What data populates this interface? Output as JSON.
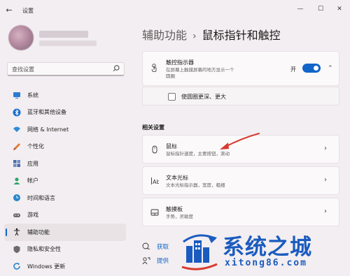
{
  "window": {
    "title": "设置"
  },
  "search": {
    "placeholder": "查找设置"
  },
  "sidebar": {
    "items": [
      {
        "label": "系统",
        "icon": "system-icon",
        "color": "#2b7bd1"
      },
      {
        "label": "蓝牙和其他设备",
        "icon": "bluetooth-icon",
        "color": "#1a6fce"
      },
      {
        "label": "网络 & Internet",
        "icon": "wifi-icon",
        "color": "#2f8bd8"
      },
      {
        "label": "个性化",
        "icon": "brush-icon",
        "color": "#e07b39"
      },
      {
        "label": "应用",
        "icon": "apps-icon",
        "color": "#4a6ba8"
      },
      {
        "label": "帐户",
        "icon": "account-icon",
        "color": "#2ea56a"
      },
      {
        "label": "时间和语言",
        "icon": "clock-globe-icon",
        "color": "#2a86c9"
      },
      {
        "label": "游戏",
        "icon": "gamepad-icon",
        "color": "#6b6b6b"
      },
      {
        "label": "辅助功能",
        "icon": "accessibility-icon",
        "color": "#1b1b1b",
        "active": true
      },
      {
        "label": "隐私和安全性",
        "icon": "shield-icon",
        "color": "#6b6b6b"
      },
      {
        "label": "Windows 更新",
        "icon": "update-icon",
        "color": "#2a86c9"
      }
    ]
  },
  "main": {
    "breadcrumb_parent": "辅助功能",
    "breadcrumb_separator": "›",
    "breadcrumb_current": "鼠标指针和触控",
    "touch_indicator": {
      "title": "触控指示器",
      "description_line1": "在屏幕上触摸屏幕的地方显示一个",
      "description_line2": "圆圈",
      "toggle_label": "开",
      "toggle_on": true
    },
    "darker_circle": {
      "label": "使圆圈更深、更大",
      "checked": false
    },
    "related_heading": "相关设置",
    "related": [
      {
        "title": "鼠标",
        "description": "鼠标指针速度，主要按钮，滚动",
        "icon": "mouse-icon"
      },
      {
        "title": "文本光标",
        "description": "文本光标指示器，宽度，粗细",
        "icon": "text-cursor-icon"
      },
      {
        "title": "触摸板",
        "description": "手势，灵敏度",
        "icon": "touchpad-icon"
      }
    ],
    "help": [
      {
        "label": "获取",
        "icon": "help-icon"
      },
      {
        "label": "提供",
        "icon": "feedback-icon"
      }
    ]
  },
  "watermark": {
    "title": "系统之城",
    "url": "xitong86.com"
  },
  "colors": {
    "accent": "#1264c9",
    "background": "#f3eef1",
    "card": "#fbf9fa",
    "watermark": "#1a5bbf",
    "annotation": "#d63b2f"
  }
}
